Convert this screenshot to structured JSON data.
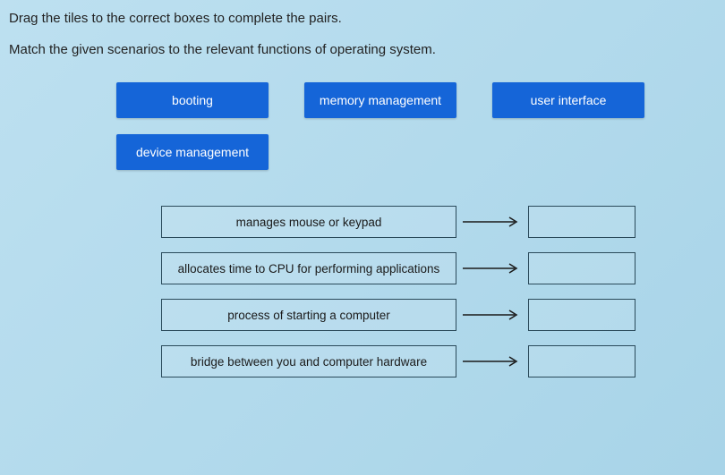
{
  "instruction1": "Drag the tiles to the correct boxes to complete the pairs.",
  "instruction2": "Match the given scenarios to the relevant functions of operating system.",
  "tiles": {
    "row1": [
      {
        "label": "booting"
      },
      {
        "label": "memory management"
      },
      {
        "label": "user interface"
      }
    ],
    "row2": [
      {
        "label": "device management"
      }
    ]
  },
  "pairs": [
    {
      "scenario": "manages mouse or keypad"
    },
    {
      "scenario": "allocates time to CPU for performing applications"
    },
    {
      "scenario": "process of starting a computer"
    },
    {
      "scenario": "bridge between you and computer hardware"
    }
  ]
}
